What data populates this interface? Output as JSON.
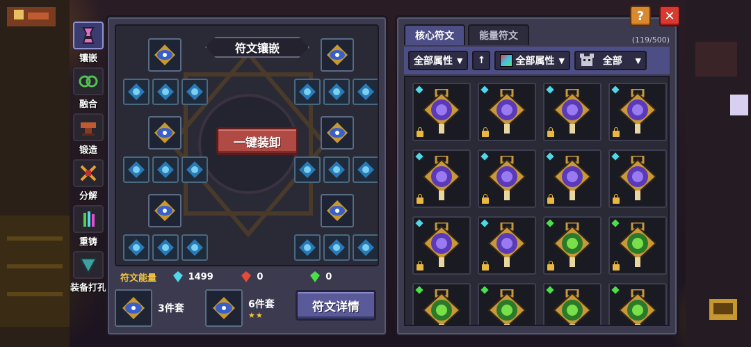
{
  "header": {
    "help_label": "?",
    "close_label": "✕"
  },
  "side_tabs": [
    {
      "label": "镶嵌",
      "icon": "rune-altar-icon",
      "active": true
    },
    {
      "label": "融合",
      "icon": "fusion-icon",
      "active": false
    },
    {
      "label": "锻造",
      "icon": "anvil-icon",
      "active": false
    },
    {
      "label": "分解",
      "icon": "disassemble-icon",
      "active": false
    },
    {
      "label": "重铸",
      "icon": "recast-crystal-icon",
      "active": false
    },
    {
      "label": "装备打孔",
      "icon": "drill-icon",
      "active": false
    }
  ],
  "inlay": {
    "title": "符文镶嵌",
    "unequip_all_label": "一键装卸",
    "energy_label": "符文能量",
    "energies": [
      {
        "icon": "blue-gem-icon",
        "color": "#4ed8e8",
        "value": "1499"
      },
      {
        "icon": "red-gem-icon",
        "color": "#e84a3a",
        "value": "0"
      },
      {
        "icon": "green-gem-icon",
        "color": "#4ae04a",
        "value": "0"
      }
    ],
    "sets": [
      {
        "label": "3件套",
        "stars": ""
      },
      {
        "label": "6件套",
        "stars": "★★"
      }
    ],
    "detail_label": "符文详情"
  },
  "rune_list": {
    "tabs": [
      "核心符文",
      "能量符文"
    ],
    "active_tab": 0,
    "count": "(119/500)",
    "filters": {
      "attr_label": "全部属性",
      "sort_label": "↑",
      "color_attr_label": "全部属性",
      "type_label": "全部"
    },
    "runes": [
      {
        "color": "purple",
        "dot": "#4ed8e8"
      },
      {
        "color": "purple",
        "dot": "#4ed8e8"
      },
      {
        "color": "purple",
        "dot": "#4ed8e8"
      },
      {
        "color": "purple",
        "dot": "#4ed8e8"
      },
      {
        "color": "purple",
        "dot": "#4ed8e8"
      },
      {
        "color": "purple",
        "dot": "#4ed8e8"
      },
      {
        "color": "purple",
        "dot": "#4ed8e8"
      },
      {
        "color": "purple",
        "dot": "#4ed8e8"
      },
      {
        "color": "purple",
        "dot": "#4ed8e8"
      },
      {
        "color": "purple",
        "dot": "#4ed8e8"
      },
      {
        "color": "green",
        "dot": "#4ae04a"
      },
      {
        "color": "green",
        "dot": "#4ae04a"
      },
      {
        "color": "green",
        "dot": "#4ae04a"
      },
      {
        "color": "green",
        "dot": "#4ae04a"
      },
      {
        "color": "green",
        "dot": "#4ae04a"
      },
      {
        "color": "green",
        "dot": "#4ae04a"
      }
    ]
  },
  "colors": {
    "accent_gold": "#f2c640",
    "panel": "#3b3a4e",
    "tab_active": "#4e4e86"
  }
}
